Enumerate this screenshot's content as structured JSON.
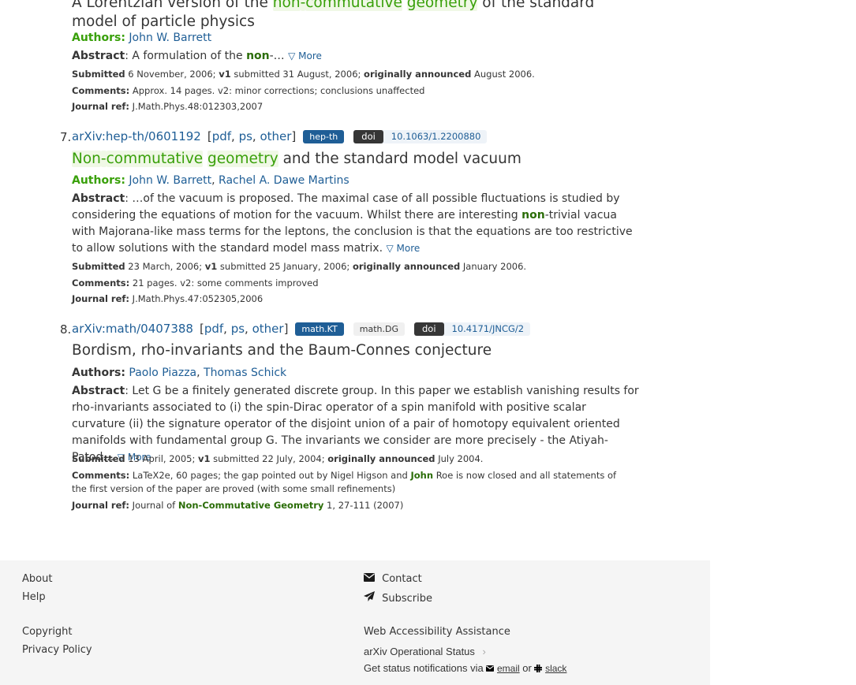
{
  "entry6": {
    "title_pre": "A Lorentzian version of the ",
    "title_h1": "non",
    "title_dash": "-",
    "title_h2": "commutative",
    "title_sp": " ",
    "title_h3": "geometry",
    "title_post": " of the standard model of particle physics",
    "authors_label": "Authors:",
    "authors": [
      "John W. Barrett"
    ],
    "abstract_label": "Abstract",
    "abstract_pre": ": A formulation of the ",
    "abstract_h": "non",
    "abstract_post": "-…",
    "more": "▽ More",
    "submitted_label": "Submitted",
    "submitted": " 6 November, 2006; ",
    "v1_label": "v1",
    "v1": " submitted 31 August, 2006; ",
    "announced_label": "originally announced",
    "announced": " August 2006.",
    "comments_label": "Comments:",
    "comments": " Approx. 14 pages. v2: minor corrections; conclusions unaffected",
    "journal_label": "Journal ref:",
    "journal": " J.Math.Phys.48:012303,2007"
  },
  "entry7": {
    "number": "7.",
    "arxiv_id": "arXiv:hep-th/0601192",
    "formats_open": "[",
    "formats": [
      "pdf",
      "ps",
      "other"
    ],
    "formats_close": "]",
    "primary_tag": "hep-th",
    "doi_label": "doi",
    "doi": "10.1063/1.2200880",
    "title_h1": "Non",
    "title_dash": "-",
    "title_h2": "commutative",
    "title_sp": " ",
    "title_h3": "geometry",
    "title_post": " and the standard model vacuum",
    "authors_label": "Authors:",
    "authors": [
      "John W. Barrett",
      "Rachel A. Dawe Martins"
    ],
    "abstract_label": "Abstract",
    "abstract_pre": ": …of the vacuum is proposed. The maximal case of all possible fluctuations is studied by considering the equations of motion for the vacuum. Whilst there are interesting ",
    "abstract_h": "non",
    "abstract_post": "-trivial vacua with Majorana-like mass terms for the leptons, the conclusion is that the equations are too restrictive to allow solutions with the standard model mass matrix. ",
    "more": "▽ More",
    "submitted_label": "Submitted",
    "submitted": " 23 March, 2006; ",
    "v1_label": "v1",
    "v1": " submitted 25 January, 2006; ",
    "announced_label": "originally announced",
    "announced": " January 2006.",
    "comments_label": "Comments:",
    "comments": " 21 pages. v2: some comments improved",
    "journal_label": "Journal ref:",
    "journal": " J.Math.Phys.47:052305,2006"
  },
  "entry8": {
    "number": "8.",
    "arxiv_id": "arXiv:math/0407388",
    "formats_open": "[",
    "formats": [
      "pdf",
      "ps",
      "other"
    ],
    "formats_close": "]",
    "primary_tag": "math.KT",
    "secondary_tag": "math.DG",
    "doi_label": "doi",
    "doi": "10.4171/JNCG/2",
    "title": "Bordism, rho-invariants and the Baum-Connes conjecture",
    "authors_label": "Authors:",
    "authors": [
      "Paolo Piazza",
      "Thomas Schick"
    ],
    "abstract_label": "Abstract",
    "abstract_text": ": Let G be a finitely generated discrete group. In this paper we establish vanishing results for rho-invariants associated to (i) the spin-Dirac operator of a spin manifold with positive scalar curvature (ii) the signature operator of the disjoint union of a pair of homotopy equivalent oriented manifolds with fundamental group G. The invariants we consider are more precisely - the Atiyah-Patod… ",
    "more": "▽ More",
    "submitted_label": "Submitted",
    "submitted": " 13 April, 2005; ",
    "v1_label": "v1",
    "v1": " submitted 22 July, 2004; ",
    "announced_label": "originally announced",
    "announced": " July 2004.",
    "comments_label": "Comments:",
    "comments_pre": " LaTeX2e, 60 pages; the gap pointed out by Nigel Higson and ",
    "comments_h": "John",
    "comments_post": " Roe is now closed and all statements of the first version of the paper are proved (with some small refinements)",
    "journal_label": "Journal ref:",
    "journal_pre": " Journal of ",
    "journal_h": "Non-Commutative Geometry",
    "journal_post": " 1, 27-111 (2007)"
  },
  "footer": {
    "about": "About",
    "help": "Help",
    "copyright": "Copyright",
    "privacy": "Privacy Policy",
    "contact": "Contact",
    "subscribe": "Subscribe",
    "accessibility": "Web Accessibility Assistance",
    "status": "arXiv Operational Status",
    "status_chevron": "›",
    "notif_pre": "Get status notifications via ",
    "notif_email": "email",
    "notif_or": " or ",
    "notif_slack": "slack"
  },
  "icons": {
    "envelope": "envelope-icon",
    "paper_plane": "paper-plane-icon",
    "slack": "slack-icon"
  },
  "colors": {
    "link": "#1f5e96",
    "highlight_text": "#39a00a",
    "highlight_bg": "#f0f8e6",
    "tag_primary": "#1f5e96",
    "footer_bg": "#f5f5f5"
  }
}
